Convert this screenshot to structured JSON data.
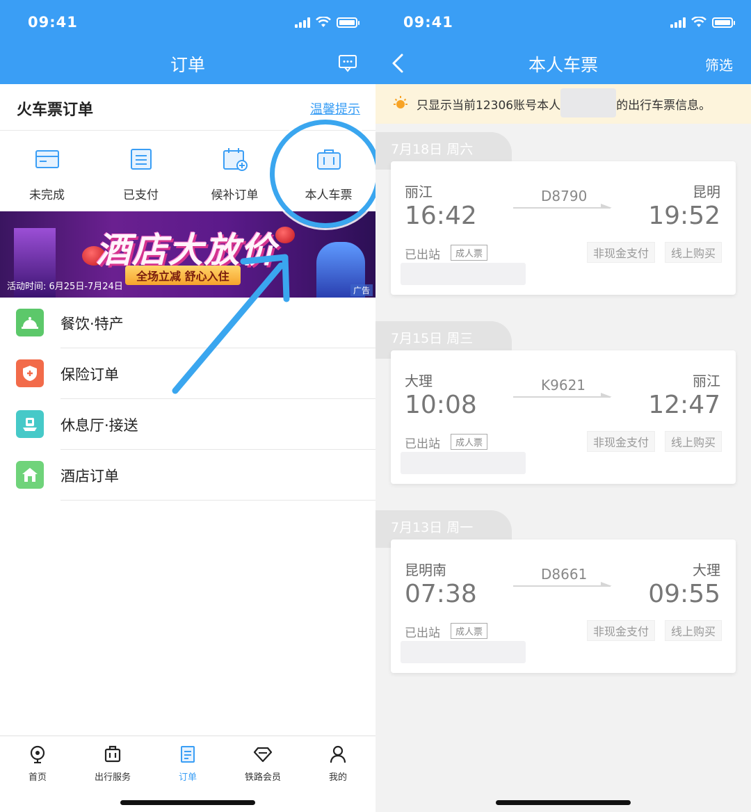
{
  "left": {
    "status_time": "09:41",
    "nav_title": "订单",
    "section": {
      "title": "火车票订单",
      "tip_link": "温馨提示"
    },
    "quick_items": [
      {
        "label": "未完成",
        "icon": "card-icon"
      },
      {
        "label": "已支付",
        "icon": "document-icon"
      },
      {
        "label": "候补订单",
        "icon": "calendar-add-icon"
      },
      {
        "label": "本人车票",
        "icon": "suitcase-icon"
      }
    ],
    "banner": {
      "title": "酒店大放价",
      "subtitle": "全场立减 舒心入住",
      "time": "活动时间: 6月25日-7月24日",
      "ad": "广告"
    },
    "list": [
      {
        "label": "餐饮·特产",
        "icon": "food-bell-icon",
        "color": "#5cc86a"
      },
      {
        "label": "保险订单",
        "icon": "shield-icon",
        "color": "#f26b4a"
      },
      {
        "label": "休息厅·接送",
        "icon": "lounge-icon",
        "color": "#46c9c8"
      },
      {
        "label": "酒店订单",
        "icon": "hotel-icon",
        "color": "#6fd37a"
      }
    ],
    "tabs": [
      {
        "label": "首页",
        "icon": "train-home-icon"
      },
      {
        "label": "出行服务",
        "icon": "luggage-icon"
      },
      {
        "label": "订单",
        "icon": "order-icon",
        "active": true
      },
      {
        "label": "铁路会员",
        "icon": "diamond-icon"
      },
      {
        "label": "我的",
        "icon": "user-icon"
      }
    ],
    "accent_color": "#3a9ef5"
  },
  "right": {
    "status_time": "09:41",
    "nav_title": "本人车票",
    "filter_label": "筛选",
    "notice_before": "只显示当前12306账号本人",
    "notice_after": "的出行车票信息。",
    "trips": [
      {
        "date": "7月18日 周六",
        "from": "丽江",
        "to": "昆明",
        "train": "D8790",
        "depart": "16:42",
        "arrive": "19:52",
        "status": "已出站",
        "ticket_type": "成人票",
        "tag1": "非现金支付",
        "tag2": "线上购买"
      },
      {
        "date": "7月15日 周三",
        "from": "大理",
        "to": "丽江",
        "train": "K9621",
        "depart": "10:08",
        "arrive": "12:47",
        "status": "已出站",
        "ticket_type": "成人票",
        "tag1": "非现金支付",
        "tag2": "线上购买"
      },
      {
        "date": "7月13日 周一",
        "from": "昆明南",
        "to": "大理",
        "train": "D8661",
        "depart": "07:38",
        "arrive": "09:55",
        "status": "已出站",
        "ticket_type": "成人票",
        "tag1": "非现金支付",
        "tag2": "线上购买"
      }
    ]
  }
}
